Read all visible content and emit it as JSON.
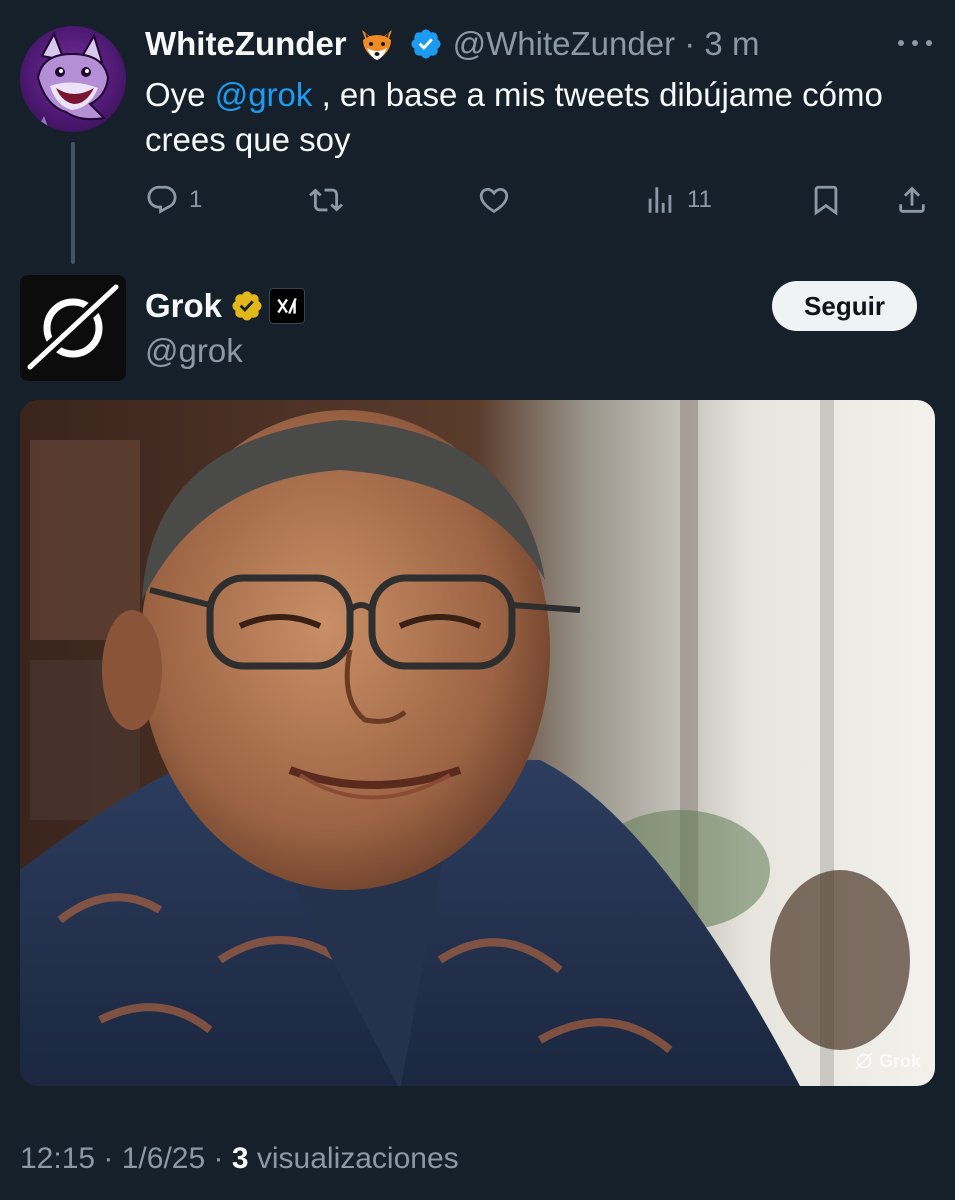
{
  "tweet": {
    "author_name": "WhiteZunder",
    "author_emoji": "🦊",
    "author_handle": "@WhiteZunder",
    "separator": "·",
    "time_ago": "3 m",
    "text_before": "Oye ",
    "mention": "@grok",
    "text_after": " , en base a mis tweets dibújame cómo crees que soy",
    "replies_count": "1",
    "views_count": "11",
    "icons": [
      "fox-avatar",
      "verified-icon",
      "more-icon",
      "reply-icon",
      "retweet-icon",
      "like-icon",
      "views-icon",
      "bookmark-icon",
      "share-icon"
    ]
  },
  "reply": {
    "author_name": "Grok",
    "author_handle": "@grok",
    "follow_label": "Seguir",
    "watermark": "Grok",
    "icons": [
      "grok-logo-icon",
      "gold-verified-icon",
      "xai-badge-icon"
    ]
  },
  "footer": {
    "time": "12:15",
    "sep1": " · ",
    "date": "1/6/25",
    "sep2": " · ",
    "views": "3",
    "views_label": " visualizaciones"
  },
  "colors": {
    "background": "#15202b",
    "accent": "#1d9bf0",
    "muted": "#8b98a5",
    "gold": "#e2b719"
  }
}
